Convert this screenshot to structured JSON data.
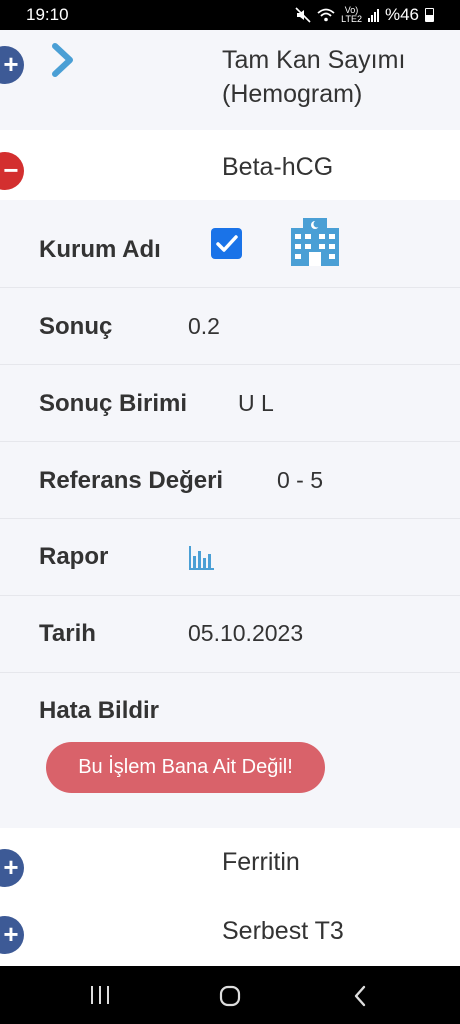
{
  "status_bar": {
    "time": "19:10",
    "network_label_top": "Vo)",
    "network_label_bottom": "LTE2",
    "battery": "%46"
  },
  "rows": {
    "hemogram": {
      "title_line1": "Tam Kan Sayımı",
      "title_line2": "(Hemogram)",
      "state": "collapsed"
    },
    "beta_hcg": {
      "title": "Beta-hCG",
      "state": "expanded"
    },
    "ferritin": {
      "title": "Ferritin",
      "state": "collapsed"
    },
    "serbest_t3": {
      "title": "Serbest T3",
      "state": "collapsed"
    }
  },
  "detail": {
    "institution_label": "Kurum Adı",
    "institution_checked": true,
    "result_label": "Sonuç",
    "result_value": "0.2",
    "unit_label": "Sonuç Birimi",
    "unit_value": "U L",
    "reference_label": "Referans Değeri",
    "reference_value": "0 - 5",
    "report_label": "Rapor",
    "date_label": "Tarih",
    "date_value": "05.10.2023",
    "report_error_label": "Hata Bildir",
    "report_error_button": "Bu İşlem Bana Ait Değil!"
  },
  "colors": {
    "plus_circle": "#3d5a96",
    "minus_circle": "#d32f2f",
    "accent_blue": "#1a73e8",
    "icon_blue": "#4a9fd5",
    "error_button": "#d9626a"
  },
  "icons": {
    "chevron": "chevron-right-icon",
    "hospital": "hospital-icon",
    "report": "bar-chart-icon"
  }
}
